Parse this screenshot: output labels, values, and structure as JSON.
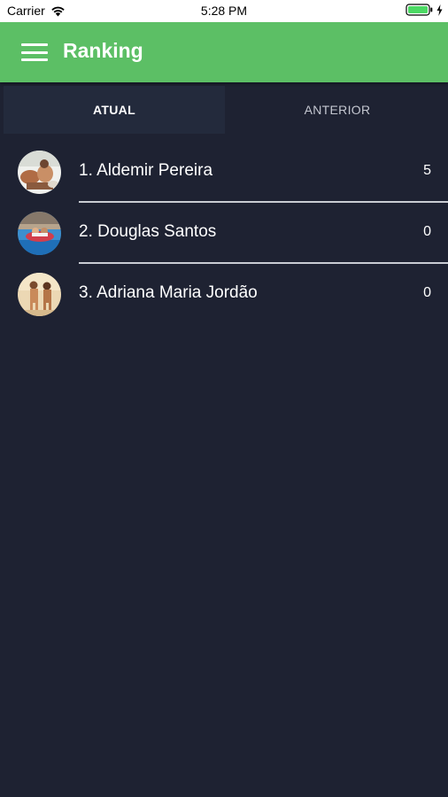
{
  "status_bar": {
    "carrier": "Carrier",
    "time": "5:28 PM",
    "icons": [
      "wifi-icon",
      "battery-icon",
      "charging-icon"
    ]
  },
  "appbar": {
    "title": "Ranking",
    "menu_icon": "hamburger-menu-icon",
    "color": "#5cbf65"
  },
  "tabs": [
    {
      "label": "ATUAL",
      "active": true
    },
    {
      "label": "ANTERIOR",
      "active": false
    }
  ],
  "ranking": [
    {
      "name": "1. Aldemir Pereira",
      "score": "5"
    },
    {
      "name": "2. Douglas Santos",
      "score": "0"
    },
    {
      "name": "3. Adriana Maria Jordão",
      "score": "0"
    }
  ],
  "colors": {
    "background": "#1e2232",
    "accent": "#5cbf65"
  }
}
